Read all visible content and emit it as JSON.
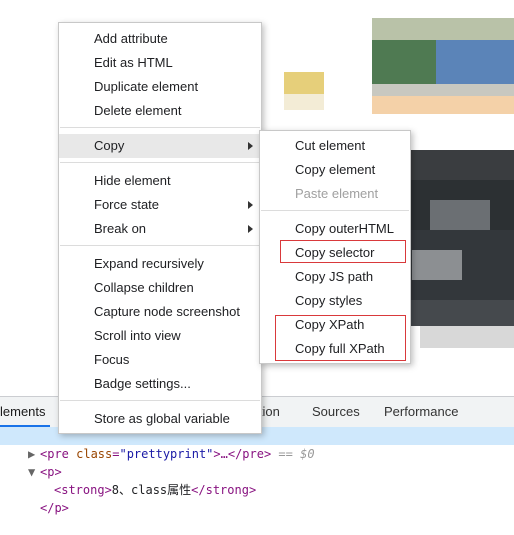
{
  "main_menu": {
    "items": [
      {
        "label": "Add attribute"
      },
      {
        "label": "Edit as HTML"
      },
      {
        "label": "Duplicate element"
      },
      {
        "label": "Delete element"
      },
      {
        "label": "Copy"
      },
      {
        "label": "Hide element"
      },
      {
        "label": "Force state"
      },
      {
        "label": "Break on"
      },
      {
        "label": "Expand recursively"
      },
      {
        "label": "Collapse children"
      },
      {
        "label": "Capture node screenshot"
      },
      {
        "label": "Scroll into view"
      },
      {
        "label": "Focus"
      },
      {
        "label": "Badge settings..."
      },
      {
        "label": "Store as global variable"
      }
    ]
  },
  "copy_submenu": {
    "items": [
      {
        "label": "Cut element"
      },
      {
        "label": "Copy element"
      },
      {
        "label": "Paste element"
      },
      {
        "label": "Copy outerHTML"
      },
      {
        "label": "Copy selector"
      },
      {
        "label": "Copy JS path"
      },
      {
        "label": "Copy styles"
      },
      {
        "label": "Copy XPath"
      },
      {
        "label": "Copy full XPath"
      }
    ]
  },
  "devtools": {
    "tabs": [
      "lements",
      "ition",
      "Sources",
      "Performance"
    ],
    "code": {
      "line1_tag_open": "<pre ",
      "line1_attr": "class",
      "line1_eq": "=",
      "line1_val": "\"prettyprint\"",
      "line1_rest": ">…</pre>",
      "line1_dollar": " == $0",
      "line2": "<p>",
      "line3_open": "<strong>",
      "line3_text": "8、class属性",
      "line3_close": "</strong>",
      "line4": "</p>"
    }
  },
  "colors": {
    "highlight_box": "#d9393b",
    "selected_row": "#cfe8fc",
    "active_tab_underline": "#1a73e8"
  }
}
